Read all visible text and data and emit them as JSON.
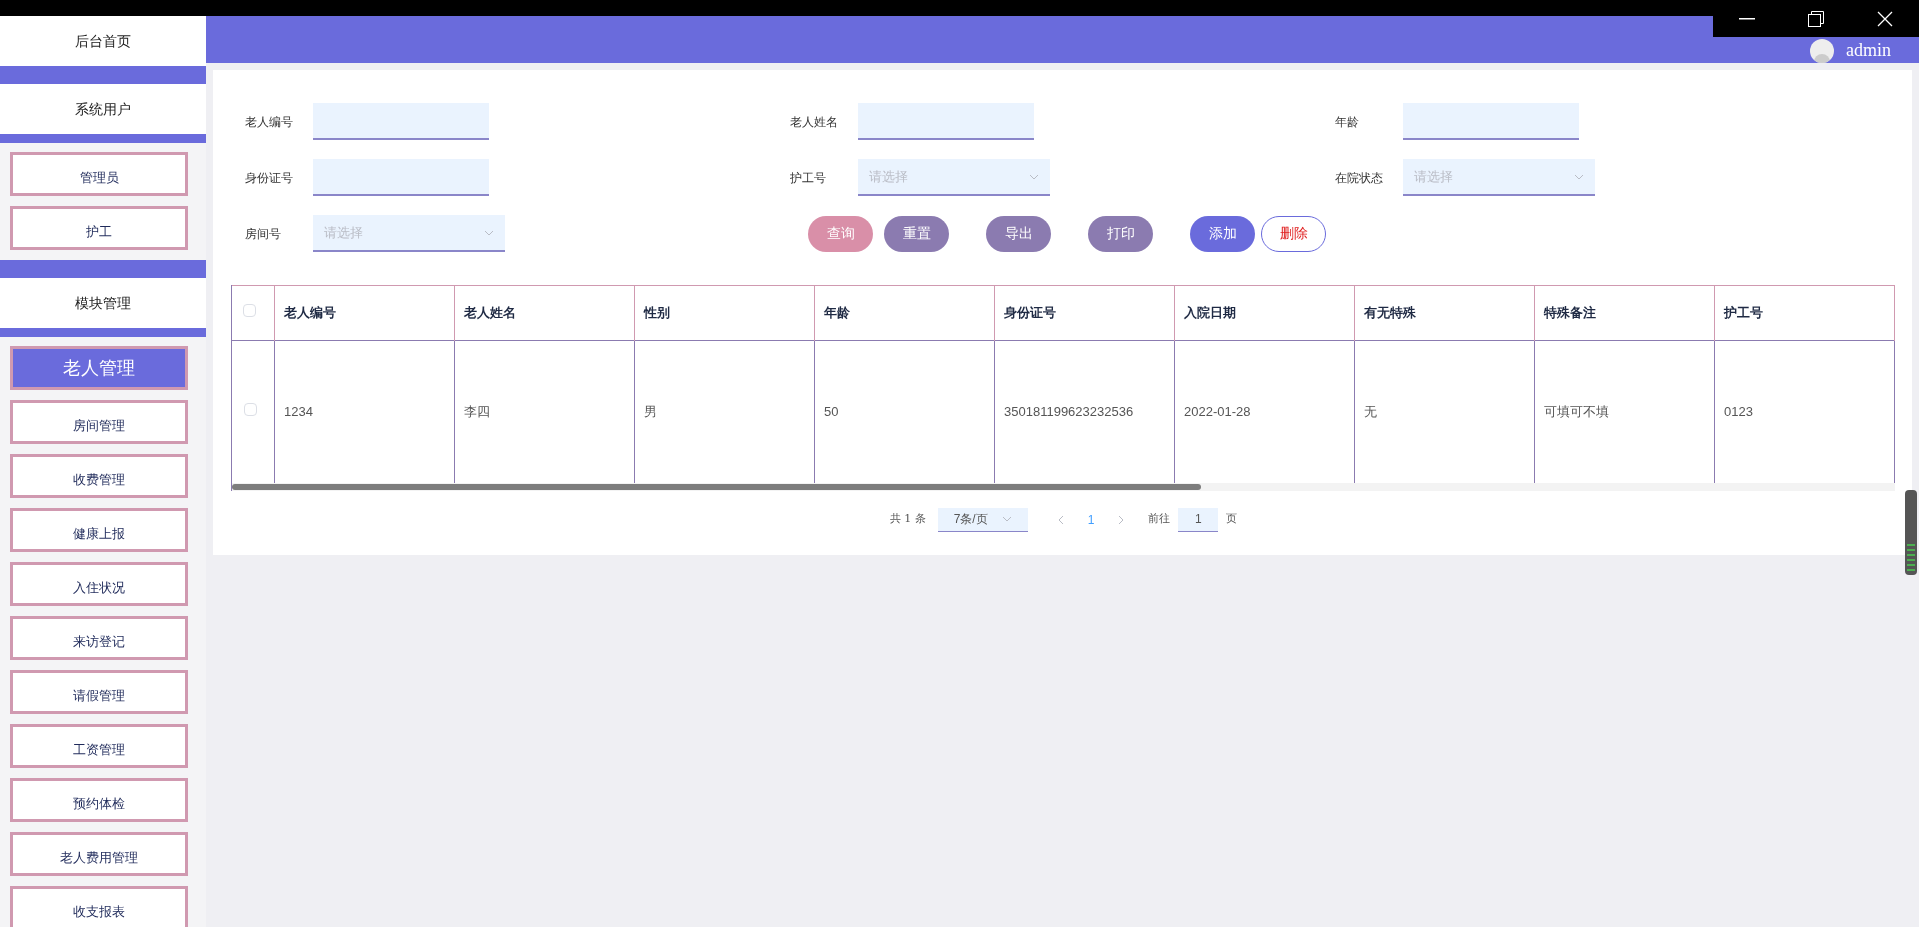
{
  "sidebar": {
    "sections": [
      {
        "title": "后台首页"
      },
      {
        "title": "系统用户",
        "items": [
          {
            "label": "管理员",
            "selected": false
          },
          {
            "label": "护工",
            "selected": false
          }
        ]
      },
      {
        "title": "模块管理",
        "items": [
          {
            "label": "老人管理",
            "selected": true
          },
          {
            "label": "房间管理",
            "selected": false
          },
          {
            "label": "收费管理",
            "selected": false
          },
          {
            "label": "健康上报",
            "selected": false
          },
          {
            "label": "入住状况",
            "selected": false
          },
          {
            "label": "来访登记",
            "selected": false
          },
          {
            "label": "请假管理",
            "selected": false
          },
          {
            "label": "工资管理",
            "selected": false
          },
          {
            "label": "预约体检",
            "selected": false
          },
          {
            "label": "老人费用管理",
            "selected": false
          },
          {
            "label": "收支报表",
            "selected": false
          }
        ]
      }
    ]
  },
  "header": {
    "user": "admin"
  },
  "filters": [
    {
      "label": "老人编号",
      "kind": "input"
    },
    {
      "label": "老人姓名",
      "kind": "input"
    },
    {
      "label": "年龄",
      "kind": "input"
    },
    {
      "label": "身份证号",
      "kind": "input"
    },
    {
      "label": "护工号",
      "kind": "select",
      "placeholder": "请选择"
    },
    {
      "label": "在院状态",
      "kind": "select",
      "placeholder": "请选择"
    },
    {
      "label": "房间号",
      "kind": "select",
      "placeholder": "请选择"
    }
  ],
  "buttons": [
    {
      "label": "查询",
      "kind": "search"
    },
    {
      "label": "重置",
      "kind": "reset"
    },
    {
      "label": "导出",
      "kind": "export"
    },
    {
      "label": "打印",
      "kind": "print"
    },
    {
      "label": "添加",
      "kind": "add"
    },
    {
      "label": "删除",
      "kind": "delete"
    }
  ],
  "table": {
    "header_checked": false,
    "columns": [
      "老人编号",
      "老人姓名",
      "性别",
      "年龄",
      "身份证号",
      "入院日期",
      "有无特殊",
      "特殊备注",
      "护工号"
    ],
    "rows": [
      {
        "checked": false,
        "cells": [
          "1234",
          "李四",
          "男",
          "50",
          "350181199623232536",
          "2022-01-28",
          "无",
          "可填可不填",
          "0123"
        ]
      }
    ]
  },
  "pagination": {
    "total": "共 1 条",
    "page_size": "7条/页",
    "pages": [
      {
        "label": "1",
        "selected": true
      }
    ],
    "goto_label": "前往",
    "goto_value": "1",
    "page_suffix": "页"
  }
}
